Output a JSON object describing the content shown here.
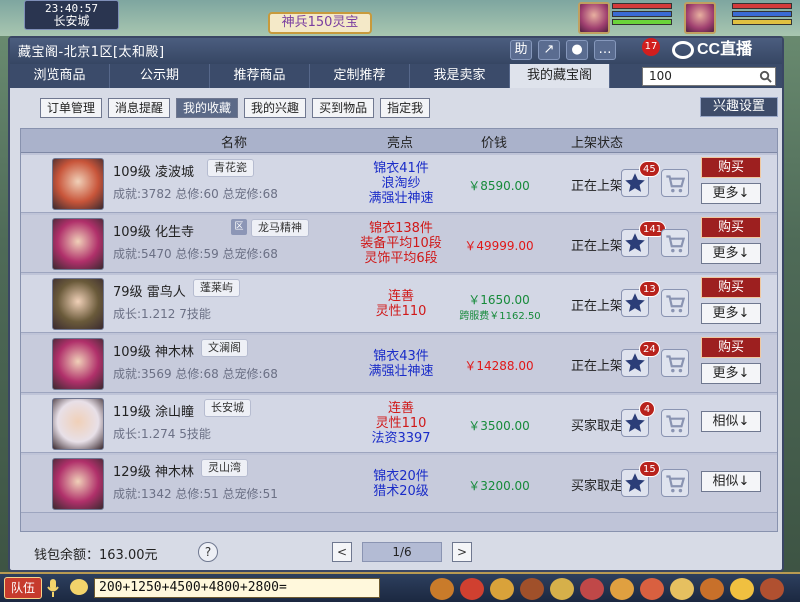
{
  "hud": {
    "time": "23:40:57",
    "city": "长安城",
    "banner": "神兵150灵宝",
    "chat_input": "200+1250+4500+4800+2800=",
    "team_button": "队伍"
  },
  "window": {
    "title": "藏宝阁-北京1区[太和殿]",
    "title_icons": [
      "助",
      "↗",
      "●",
      "…"
    ],
    "cc_badge": "17",
    "cc_logo_text": "CC直播"
  },
  "tabs": [
    {
      "label": "浏览商品",
      "active": false
    },
    {
      "label": "公示期",
      "active": false
    },
    {
      "label": "推荐商品",
      "active": false
    },
    {
      "label": "定制推荐",
      "active": false
    },
    {
      "label": "我是卖家",
      "active": false
    },
    {
      "label": "我的藏宝阁",
      "active": true
    }
  ],
  "search": {
    "value": "100"
  },
  "subtabs": [
    {
      "label": "订单管理",
      "active": false
    },
    {
      "label": "消息提醒",
      "active": false
    },
    {
      "label": "我的收藏",
      "active": true
    },
    {
      "label": "我的兴趣",
      "active": false
    },
    {
      "label": "买到物品",
      "active": false
    },
    {
      "label": "指定我",
      "active": false
    }
  ],
  "interest_settings": "兴趣设置",
  "table": {
    "headers": [
      "名称",
      "亮点",
      "价钱",
      "上架状态"
    ],
    "rows": [
      {
        "level": "109级",
        "name": "凌波城",
        "server": "青花瓷",
        "sym": "",
        "stats": "成就:3782  总修:60  总宠修:68",
        "highlights": [
          {
            "t": "锦衣41件",
            "c": "blue"
          },
          {
            "t": "浪淘纱",
            "c": "blue"
          },
          {
            "t": "满强壮神速",
            "c": "blue"
          }
        ],
        "price": "￥8590.00",
        "price_color": "green",
        "fee": "",
        "status": "正在上架",
        "fav": "45",
        "buy": "购买",
        "more": "更多↓",
        "similar": "",
        "avatar_color": "#c8553a"
      },
      {
        "level": "109级",
        "name": "化生寺",
        "server": "龙马精神",
        "sym": "区",
        "stats": "成就:5470  总修:59  总宠修:68",
        "highlights": [
          {
            "t": "锦衣138件",
            "c": "red"
          },
          {
            "t": "装备平均10段",
            "c": "red"
          },
          {
            "t": "灵饰平均6段",
            "c": "red"
          }
        ],
        "price": "￥49999.00",
        "price_color": "red",
        "fee": "",
        "status": "正在上架",
        "fav": "141",
        "buy": "购买",
        "more": "更多↓",
        "similar": "",
        "avatar_color": "#b0306a"
      },
      {
        "level": "79级",
        "name": "雷鸟人",
        "server": "蓬莱屿",
        "sym": "",
        "stats": "成长:1.212  7技能",
        "highlights": [
          {
            "t": "连善",
            "c": "red"
          },
          {
            "t": "灵性110",
            "c": "red"
          }
        ],
        "price": "￥1650.00",
        "price_color": "green",
        "fee": "跨服费￥1162.50",
        "status": "正在上架",
        "fav": "13",
        "buy": "购买",
        "more": "更多↓",
        "similar": "",
        "avatar_color": "#6a5a3a"
      },
      {
        "level": "109级",
        "name": "神木林",
        "server": "文澜阁",
        "sym": "",
        "stats": "成就:3569  总修:68  总宠修:68",
        "highlights": [
          {
            "t": "锦衣43件",
            "c": "blue"
          },
          {
            "t": "满强壮神速",
            "c": "blue"
          }
        ],
        "price": "￥14288.00",
        "price_color": "red",
        "fee": "",
        "status": "正在上架",
        "fav": "24",
        "buy": "购买",
        "more": "更多↓",
        "similar": "",
        "avatar_color": "#b0306a"
      },
      {
        "level": "119级",
        "name": "涂山瞳",
        "server": "长安城",
        "sym": "",
        "stats": "成长:1.274  5技能",
        "highlights": [
          {
            "t": "连善",
            "c": "red"
          },
          {
            "t": "灵性110",
            "c": "red"
          },
          {
            "t": "法资3397",
            "c": "blue"
          }
        ],
        "price": "￥3500.00",
        "price_color": "green",
        "fee": "",
        "status": "买家取走",
        "fav": "4",
        "buy": "",
        "more": "",
        "similar": "相似↓",
        "avatar_color": "#e8e0e8"
      },
      {
        "level": "129级",
        "name": "神木林",
        "server": "灵山湾",
        "sym": "",
        "stats": "成就:1342  总修:51  总宠修:51",
        "highlights": [
          {
            "t": "锦衣20件",
            "c": "blue"
          },
          {
            "t": "猎术20级",
            "c": "blue"
          }
        ],
        "price": "￥3200.00",
        "price_color": "green",
        "fee": "",
        "status": "买家取走",
        "fav": "15",
        "buy": "",
        "more": "",
        "similar": "相似↓",
        "avatar_color": "#b0306a"
      }
    ]
  },
  "footer": {
    "balance": "钱包余额：163.00元",
    "help": "?",
    "page": "1/6",
    "prev": "<",
    "next": ">"
  }
}
